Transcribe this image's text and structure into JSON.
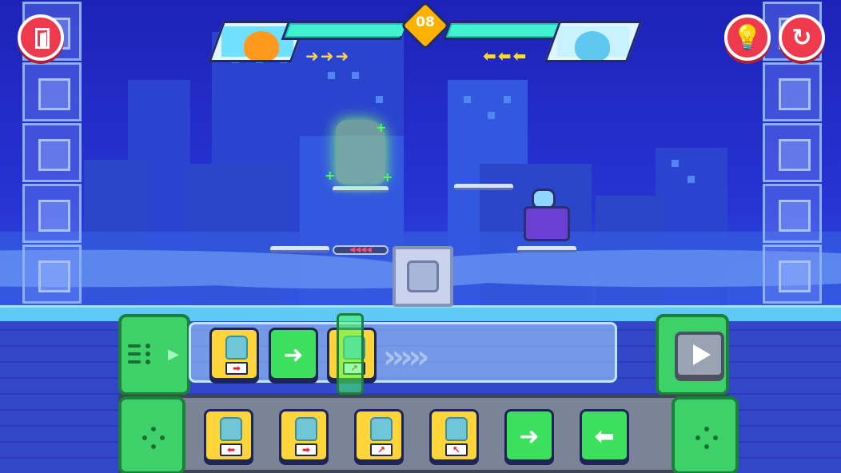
{
  "hud": {
    "round_number": "08",
    "player_icon": "orange-dino-icon",
    "enemy_icon": "blue-dino-icon",
    "player_moves": "➜➜➜",
    "enemy_moves": "⬅⬅⬅",
    "player_health": 1.0,
    "enemy_health": 1.0
  },
  "buttons": {
    "exit_icon": "door-exit-icon",
    "hint_icon": "lightbulb-icon",
    "restart_icon": "restart-icon",
    "play_icon": "play-icon"
  },
  "program_queue": [
    {
      "kind": "move",
      "arrow": "➡",
      "color": "yellow"
    },
    {
      "kind": "dash",
      "arrow": "➜",
      "color": "green"
    },
    {
      "kind": "jump",
      "arrow": "↗",
      "color": "yellow"
    }
  ],
  "command_palette": [
    {
      "kind": "move",
      "arrow": "⬅",
      "color": "yellow"
    },
    {
      "kind": "move",
      "arrow": "➡",
      "color": "yellow"
    },
    {
      "kind": "jump",
      "arrow": "↗",
      "color": "yellow"
    },
    {
      "kind": "jump",
      "arrow": "↖",
      "color": "yellow"
    },
    {
      "kind": "dash",
      "arrow": "➜",
      "color": "green"
    },
    {
      "kind": "dash",
      "arrow": "⬅",
      "color": "green"
    }
  ],
  "colors": {
    "accent_red": "#ef3a4d",
    "panel_green": "#3ed16a",
    "card_yellow": "#ffd53a",
    "card_green": "#3be05d",
    "health": "#3ff2d0",
    "round_badge": "#ffb300"
  }
}
